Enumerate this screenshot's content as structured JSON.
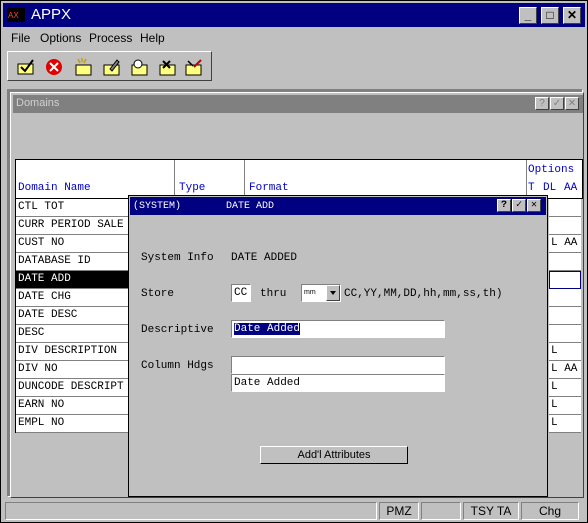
{
  "app": {
    "title": "APPX"
  },
  "menu": [
    "File",
    "Options",
    "Process",
    "Help"
  ],
  "toolbar": {
    "icons": [
      "check-folder-icon",
      "cancel-icon",
      "new-folder-icon",
      "edit-folder-icon",
      "find-folder-icon",
      "delete-folder-icon",
      "clear-folder-icon"
    ]
  },
  "domains_window": {
    "title": "Domains",
    "columns": {
      "options": "Options",
      "name": "Domain Name",
      "type": "Type",
      "format": "Format",
      "t": "T",
      "dl": "DL",
      "aa": "AA"
    },
    "rows": [
      "CTL TOT",
      "CURR PERIOD SALE",
      "CUST NO",
      "DATABASE ID",
      "DATE ADD",
      "DATE CHG",
      "DATE DESC",
      "DESC",
      "DIV DESCRIPTION",
      "DIV NO",
      "DUNCODE DESCRIPT",
      "EARN NO",
      "EMPL NO"
    ],
    "right_values": [
      "",
      "",
      "L AA",
      "",
      "",
      "",
      "",
      "",
      "L",
      "L AA",
      "L",
      "L",
      "L"
    ]
  },
  "dialog": {
    "system_tag": "(SYSTEM)",
    "title": "DATE ADD",
    "system_info_label": "System Info",
    "system_info_value": "DATE ADDED",
    "store_label": "Store",
    "store_from": "CC",
    "thru_label": "thru",
    "store_to": "mm",
    "store_format_hint": "CC,YY,MM,DD,hh,mm,ss,th)",
    "descriptive_label": "Descriptive",
    "descriptive_value": "Date Added",
    "column_hdgs_label": "Column Hdgs",
    "column_hdg_1": "",
    "column_hdg_2": "Date Added",
    "addl_button": "Add'l Attributes"
  },
  "status": {
    "cells": [
      "",
      "",
      "PMZ",
      "",
      "TSY TA",
      "Chg"
    ]
  },
  "colors": {
    "title_active": "#000080",
    "window_bg": "#c0c0c0",
    "header_text": "#0000cc"
  }
}
